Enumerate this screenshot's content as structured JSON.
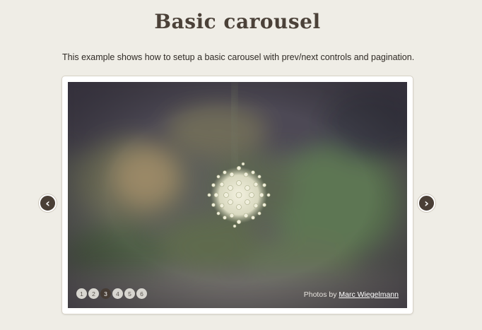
{
  "page": {
    "title": "Basic carousel",
    "intro": "This example shows how to setup a basic carousel with prev/next controls and pagination."
  },
  "carousel": {
    "prev_label": "‹",
    "next_label": "›",
    "pages": [
      "1",
      "2",
      "3",
      "4",
      "5",
      "6"
    ],
    "active_page": "3",
    "credit_prefix": "Photos by",
    "credit_author": "Marc Wiegelmann"
  },
  "colors": {
    "background": "#efede6",
    "accent": "#463c34",
    "inactive_dot": "#d8d6d0"
  }
}
